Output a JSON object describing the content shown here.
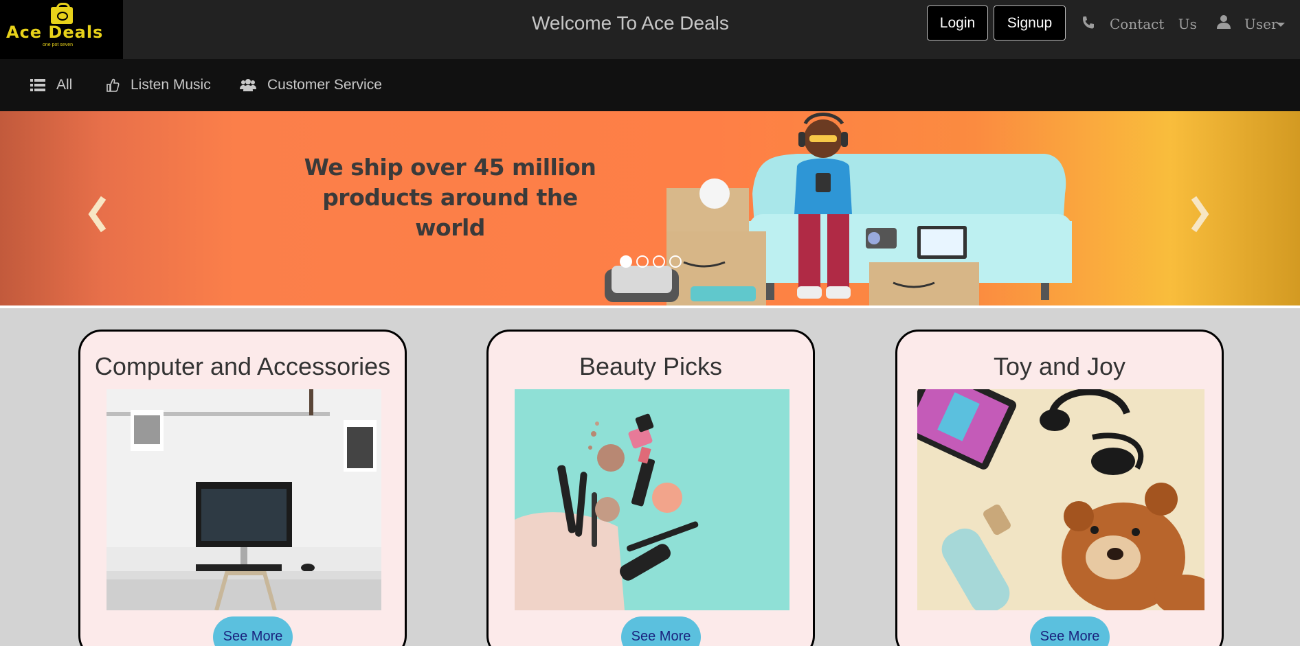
{
  "header": {
    "logo_text": "Ace Deals",
    "logo_tagline": "one pot seven",
    "welcome": "Welcome To Ace Deals",
    "login_label": "Login",
    "signup_label": "Signup",
    "contact_label": "Contact Us",
    "user_label": "User"
  },
  "nav": {
    "items": [
      {
        "label": "All",
        "icon": "list-icon"
      },
      {
        "label": "Listen Music",
        "icon": "thumbs-up-icon"
      },
      {
        "label": "Customer Service",
        "icon": "users-icon"
      }
    ]
  },
  "carousel": {
    "caption_line1": "We ship over 45 million",
    "caption_line2": "products around the world",
    "slide_count": 4,
    "active_slide": 1
  },
  "cards": [
    {
      "title": "Computer and Accessories",
      "button": "See More"
    },
    {
      "title": "Beauty Picks",
      "button": "See More"
    },
    {
      "title": "Toy and Joy",
      "button": "See More"
    }
  ],
  "colors": {
    "topbar": "#222222",
    "navbar": "#111111",
    "logo_yellow": "#e8d21a",
    "card_bg": "#fceaea",
    "button_blue": "#5bc0de",
    "page_bg": "#d3d3d3"
  }
}
